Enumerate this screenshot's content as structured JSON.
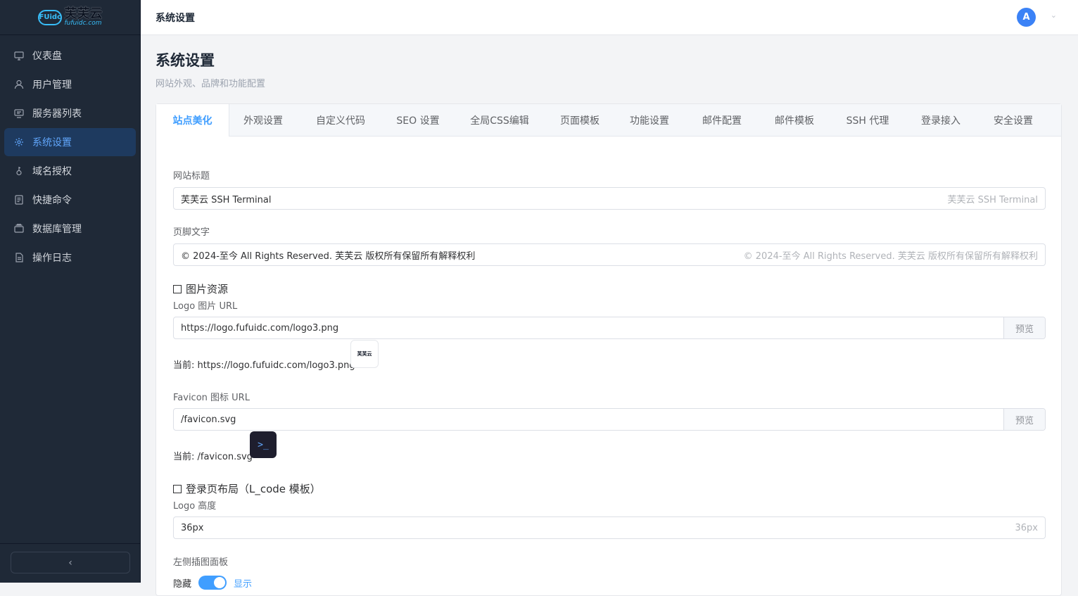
{
  "brand": {
    "logo_cn": "芙芙云",
    "logo_en": "fufuidc.com",
    "logo_mark": "FUidc"
  },
  "sidebar": {
    "items": [
      {
        "label": "仪表盘",
        "icon": "monitor-icon"
      },
      {
        "label": "用户管理",
        "icon": "user-icon"
      },
      {
        "label": "服务器列表",
        "icon": "server-icon"
      },
      {
        "label": "系统设置",
        "icon": "gear-icon",
        "active": true
      },
      {
        "label": "域名授权",
        "icon": "key-icon"
      },
      {
        "label": "快捷命令",
        "icon": "document-icon"
      },
      {
        "label": "数据库管理",
        "icon": "database-icon"
      },
      {
        "label": "操作日志",
        "icon": "log-icon"
      }
    ],
    "collapse_label": "‹"
  },
  "topbar": {
    "title": "系统设置",
    "avatar": "A",
    "caret": "⌄"
  },
  "page": {
    "title": "系统设置",
    "subtitle": "网站外观、品牌和功能配置"
  },
  "tabs": [
    "站点美化",
    "外观设置",
    "自定义代码",
    "SEO 设置",
    "全局CSS编辑",
    "页面模板",
    "功能设置",
    "邮件配置",
    "邮件模板",
    "SSH 代理",
    "登录接入",
    "安全设置"
  ],
  "form": {
    "site_title": {
      "label": "网站标题",
      "value": "芙芙云 SSH Terminal",
      "placeholder": "芙芙云 SSH Terminal"
    },
    "footer_text": {
      "label": "页脚文字",
      "value": "© 2024-至今 All Rights Reserved. 芙芙云 版权所有保留所有解释权利",
      "placeholder": "© 2024-至今 All Rights Reserved. 芙芙云 版权所有保留所有解释权利"
    },
    "image_section": {
      "title": "图片资源"
    },
    "logo_url": {
      "label": "Logo 图片 URL",
      "value": "https://logo.fufuidc.com/logo3.png",
      "button": "预览",
      "current": "当前: https://logo.fufuidc.com/logo3.png",
      "thumb_text": "芙芙云"
    },
    "favicon_url": {
      "label": "Favicon 图标 URL",
      "value": "/favicon.svg",
      "button": "预览",
      "current": "当前: /favicon.svg",
      "thumb_text": ">_"
    },
    "login_section": {
      "title": "登录页布局（L_code 模板）"
    },
    "logo_height": {
      "label": "Logo 高度",
      "value": "36px",
      "placeholder": "36px"
    },
    "left_panel": {
      "label": "左侧插图面板",
      "off_label": "隐藏",
      "on_label": "显示",
      "enabled": true
    }
  }
}
